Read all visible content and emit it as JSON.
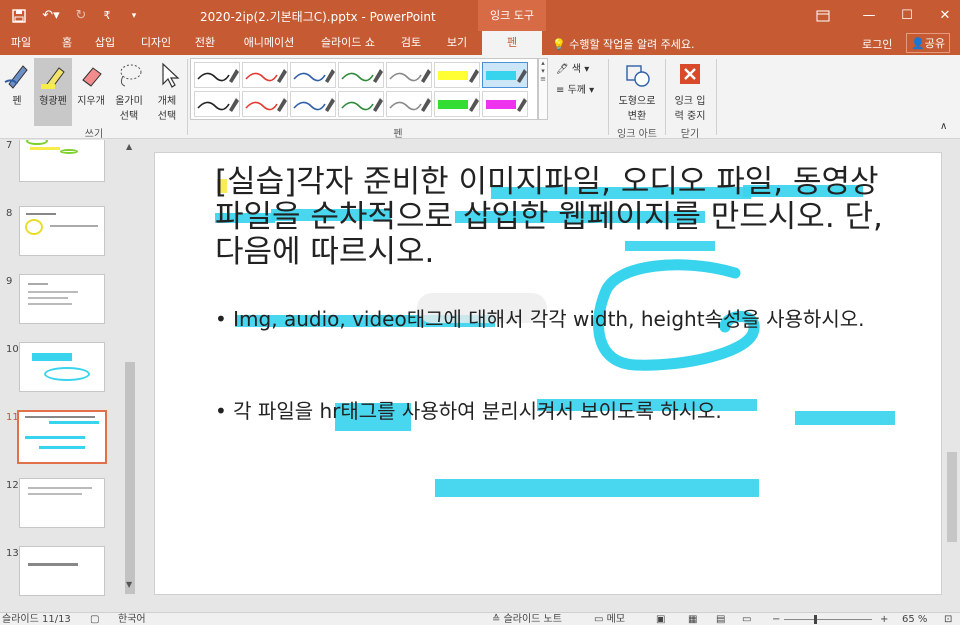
{
  "titlebar": {
    "doc_title": "2020-2ip(2.기본태그C).pptx - PowerPoint",
    "tool_context": "잉크 도구",
    "qat_customize": "₹"
  },
  "tabs": [
    {
      "label": "파일"
    },
    {
      "label": "홈"
    },
    {
      "label": "삽입"
    },
    {
      "label": "디자인"
    },
    {
      "label": "전환"
    },
    {
      "label": "애니메이션"
    },
    {
      "label": "슬라이드 쇼"
    },
    {
      "label": "검토"
    },
    {
      "label": "보기"
    },
    {
      "label": "펜"
    }
  ],
  "tellme": "수행할 작업을 알려 주세요.",
  "login": "로그인",
  "share": "공유",
  "ribbon": {
    "write_group": {
      "label": "쓰기",
      "pen": "펜",
      "highlighter": "형광펜",
      "eraser": "지우개",
      "lasso": [
        "올가미",
        "선택"
      ],
      "object_select": [
        "개체",
        "선택"
      ]
    },
    "pens_group": {
      "label": "펜",
      "color": "색",
      "thickness": "두께"
    },
    "ink_art": {
      "label": "잉크 아트",
      "convert": [
        "도형으로",
        "변환"
      ]
    },
    "close_group": {
      "label": "닫기",
      "stop": [
        "잉크 입",
        "력 중지"
      ]
    },
    "pen_swatches": [
      {
        "color": "#222222",
        "row": 0
      },
      {
        "color": "#e03c31",
        "row": 0
      },
      {
        "color": "#2e5fa8",
        "row": 0
      },
      {
        "color": "#2e8b3a",
        "row": 0
      },
      {
        "color": "#8a8a8a",
        "row": 0
      },
      {
        "color": "#ffff33",
        "row": 0,
        "marker": true
      },
      {
        "color": "#38d4ee",
        "row": 0,
        "marker": true,
        "selected": true
      },
      {
        "color": "#222222",
        "row": 1
      },
      {
        "color": "#e03c31",
        "row": 1
      },
      {
        "color": "#2e5fa8",
        "row": 1
      },
      {
        "color": "#2e8b3a",
        "row": 1
      },
      {
        "color": "#8a8a8a",
        "row": 1
      },
      {
        "color": "#33dd33",
        "row": 1,
        "marker": true
      },
      {
        "color": "#ee33ee",
        "row": 1,
        "marker": true
      }
    ]
  },
  "thumbnails": [
    {
      "num": "7"
    },
    {
      "num": "8"
    },
    {
      "num": "9"
    },
    {
      "num": "10"
    },
    {
      "num": "11",
      "active": true
    },
    {
      "num": "12"
    },
    {
      "num": "13"
    }
  ],
  "slide": {
    "title": "[실습]각자 준비한 이미지파일, 오디오 파일, 동영상 파일을 순차적으로 삽입한 웹페이지를 만드시오. 단, 다음에 따르시오.",
    "bullet1": "Img, audio, video태그에 대해서 각각 width, height속성을 사용하시오.",
    "bullet2": "각 파일을 hr태그를 사용하여 분리시켜서 보이도록 하시오."
  },
  "colors": {
    "accent": "#c55a33",
    "ink": "#38d4ee"
  },
  "status": {
    "slide_counter": "슬라이드 11/13",
    "language": "한국어",
    "notes": "슬라이드 노트",
    "comments": "메모",
    "zoom": "65 %"
  }
}
